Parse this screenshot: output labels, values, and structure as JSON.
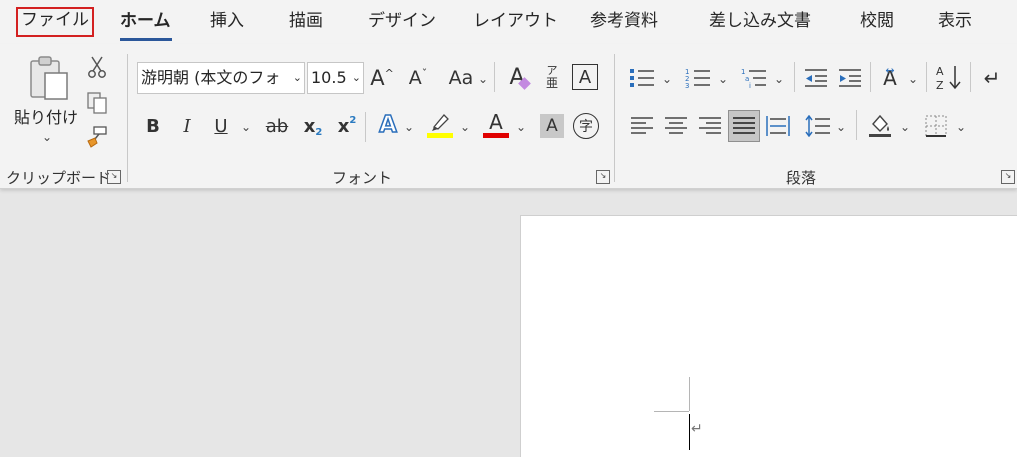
{
  "tabs": [
    "ファイル",
    "ホーム",
    "挿入",
    "描画",
    "デザイン",
    "レイアウト",
    "参考資料",
    "差し込み文書",
    "校閲",
    "表示"
  ],
  "clipboard": {
    "paste_label": "貼り付け",
    "group_label": "クリップボード"
  },
  "font": {
    "font_name": "游明朝 (本文のフォ",
    "font_size": "10.5",
    "aa_label": "Aa",
    "group_label": "フォント",
    "highlight_color": "#ffff00",
    "font_color": "#e00000"
  },
  "paragraph": {
    "group_label": "段落"
  },
  "icons": {
    "clipboard": [
      "paste-icon",
      "cut-icon",
      "copy-icon",
      "format-painter-icon"
    ],
    "font": [
      "grow-font-icon",
      "shrink-font-icon",
      "change-case-icon",
      "clear-formatting-icon",
      "phonetic-guide-icon",
      "character-border-icon",
      "bold-icon",
      "italic-icon",
      "underline-icon",
      "strikethrough-icon",
      "subscript-icon",
      "superscript-icon",
      "text-effects-icon",
      "highlight-icon",
      "font-color-icon",
      "character-shading-icon",
      "enclose-characters-icon"
    ],
    "paragraph": [
      "bullets-icon",
      "numbering-icon",
      "multilevel-list-icon",
      "decrease-indent-icon",
      "increase-indent-icon",
      "asian-layout-icon",
      "sort-icon",
      "show-hide-icon",
      "align-left-icon",
      "center-icon",
      "align-right-icon",
      "justify-icon",
      "distributed-icon",
      "line-spacing-icon",
      "shading-icon",
      "borders-icon"
    ]
  }
}
